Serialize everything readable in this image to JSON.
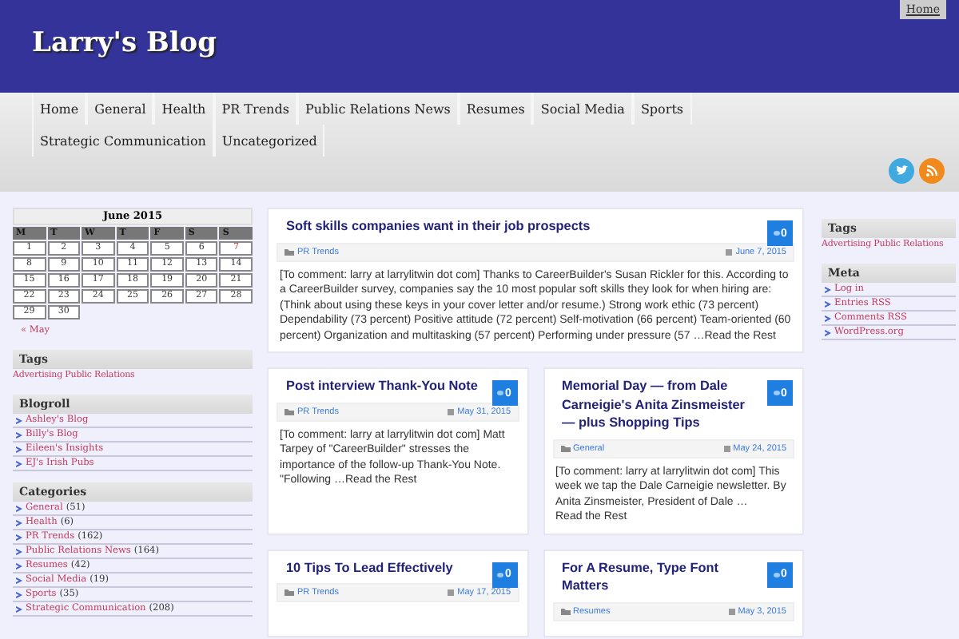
{
  "header": {
    "title": "Larry's Blog",
    "top_link": "Home"
  },
  "nav": [
    "Home",
    "General",
    "Health",
    "PR Trends",
    "Public Relations News",
    "Resumes",
    "Social Media",
    "Sports",
    "Strategic Communication",
    "Uncategorized"
  ],
  "calendar": {
    "caption": "June 2015",
    "weekdays": [
      "M",
      "T",
      "W",
      "T",
      "F",
      "S",
      "S"
    ],
    "weeks": [
      [
        {
          "label": "1",
          "linked": false
        },
        {
          "label": "2",
          "linked": false
        },
        {
          "label": "3",
          "linked": false
        },
        {
          "label": "4",
          "linked": false
        },
        {
          "label": "5",
          "linked": false
        },
        {
          "label": "6",
          "linked": false
        },
        {
          "label": "7",
          "linked": true
        }
      ],
      [
        {
          "label": "8",
          "linked": false
        },
        {
          "label": "9",
          "linked": false
        },
        {
          "label": "10",
          "linked": false
        },
        {
          "label": "11",
          "linked": false
        },
        {
          "label": "12",
          "linked": false
        },
        {
          "label": "13",
          "linked": false
        },
        {
          "label": "14",
          "linked": false
        }
      ],
      [
        {
          "label": "15",
          "linked": false
        },
        {
          "label": "16",
          "linked": false
        },
        {
          "label": "17",
          "linked": false
        },
        {
          "label": "18",
          "linked": false
        },
        {
          "label": "19",
          "linked": false
        },
        {
          "label": "20",
          "linked": false
        },
        {
          "label": "21",
          "linked": false
        }
      ],
      [
        {
          "label": "22",
          "linked": false
        },
        {
          "label": "23",
          "linked": false
        },
        {
          "label": "24",
          "linked": false
        },
        {
          "label": "25",
          "linked": false
        },
        {
          "label": "26",
          "linked": false
        },
        {
          "label": "27",
          "linked": false
        },
        {
          "label": "28",
          "linked": false
        }
      ],
      [
        {
          "label": "29",
          "linked": false
        },
        {
          "label": "30",
          "linked": false
        }
      ]
    ],
    "prev": "« May"
  },
  "left_widgets": [
    {
      "title": "Tags",
      "kind": "tags",
      "items": [
        {
          "label": "Advertising Public Relations"
        }
      ]
    },
    {
      "title": "Blogroll",
      "kind": "list",
      "items": [
        {
          "label": "Ashley's Blog"
        },
        {
          "label": "Billy's Blog"
        },
        {
          "label": "Eileen's Insights"
        },
        {
          "label": "EJ's Irish Pubs"
        }
      ]
    },
    {
      "title": "Categories",
      "kind": "list",
      "items": [
        {
          "label": "General",
          "count": "(51)"
        },
        {
          "label": "Health",
          "count": "(6)"
        },
        {
          "label": "PR Trends",
          "count": "(162)"
        },
        {
          "label": "Public Relations News",
          "count": "(164)"
        },
        {
          "label": "Resumes",
          "count": "(42)"
        },
        {
          "label": "Social Media",
          "count": "(19)"
        },
        {
          "label": "Sports",
          "count": "(35)"
        },
        {
          "label": "Strategic Communication",
          "count": "(208)"
        }
      ]
    }
  ],
  "featured": {
    "title": "Soft skills companies want in their job prospects",
    "comments": "0",
    "category": "PR Trends",
    "date": "June 7, 2015",
    "excerpt": "[To comment: larry at larrylitwin dot com] Thanks to CareerBuilder's Susan Rickler for this. According to a CareerBuilder survey, companies say the 10 most popular soft skills they look for when hiring are: (Think about using these keys in your cover letter and/or resume.) Strong work ethic (73 percent) Dependability (73 percent) Positive attitude (72 percent) Self-motivation (66 percent) Team-oriented (60 percent) Organization and multitasking (57 percent) Performing under pressure (57 …",
    "read_more": "Read the Rest"
  },
  "posts": [
    {
      "title": "Post interview Thank-You Note",
      "comments": "0",
      "category": "PR Trends",
      "date": "May 31, 2015",
      "excerpt": "[To comment: larry at larrylitwin dot com] Matt Tarpey of \"CareerBuilder\" stresses the importance of the follow-up Thank-You Note. \"Following …",
      "read_more": "Read the Rest"
    },
    {
      "title": "Memorial Day — from Dale Carneigie's Anita Zinsmeister — plus Shopping Tips",
      "comments": "0",
      "category": "General",
      "date": "May 24, 2015",
      "excerpt": "[To comment: larry at larrylitwin dot com] This week we tap the Dale Carneigie newsletter. By Anita Zinsmeister, President of Dale …",
      "read_more": "Read the Rest"
    },
    {
      "title": "10 Tips To Lead Effectively",
      "comments": "0",
      "category": "PR Trends",
      "date": "May 17, 2015"
    },
    {
      "title": "For A Resume, Type Font Matters",
      "comments": "0",
      "category": "Resumes",
      "date": "May 3, 2015"
    }
  ],
  "right_widgets": [
    {
      "title": "Tags",
      "kind": "tags",
      "items": [
        {
          "label": "Advertising Public Relations"
        }
      ]
    },
    {
      "title": "Meta",
      "kind": "list",
      "items": [
        {
          "label": "Log in"
        },
        {
          "label": "Entries RSS"
        },
        {
          "label": "Comments RSS"
        },
        {
          "label": "WordPress.org"
        }
      ]
    }
  ]
}
